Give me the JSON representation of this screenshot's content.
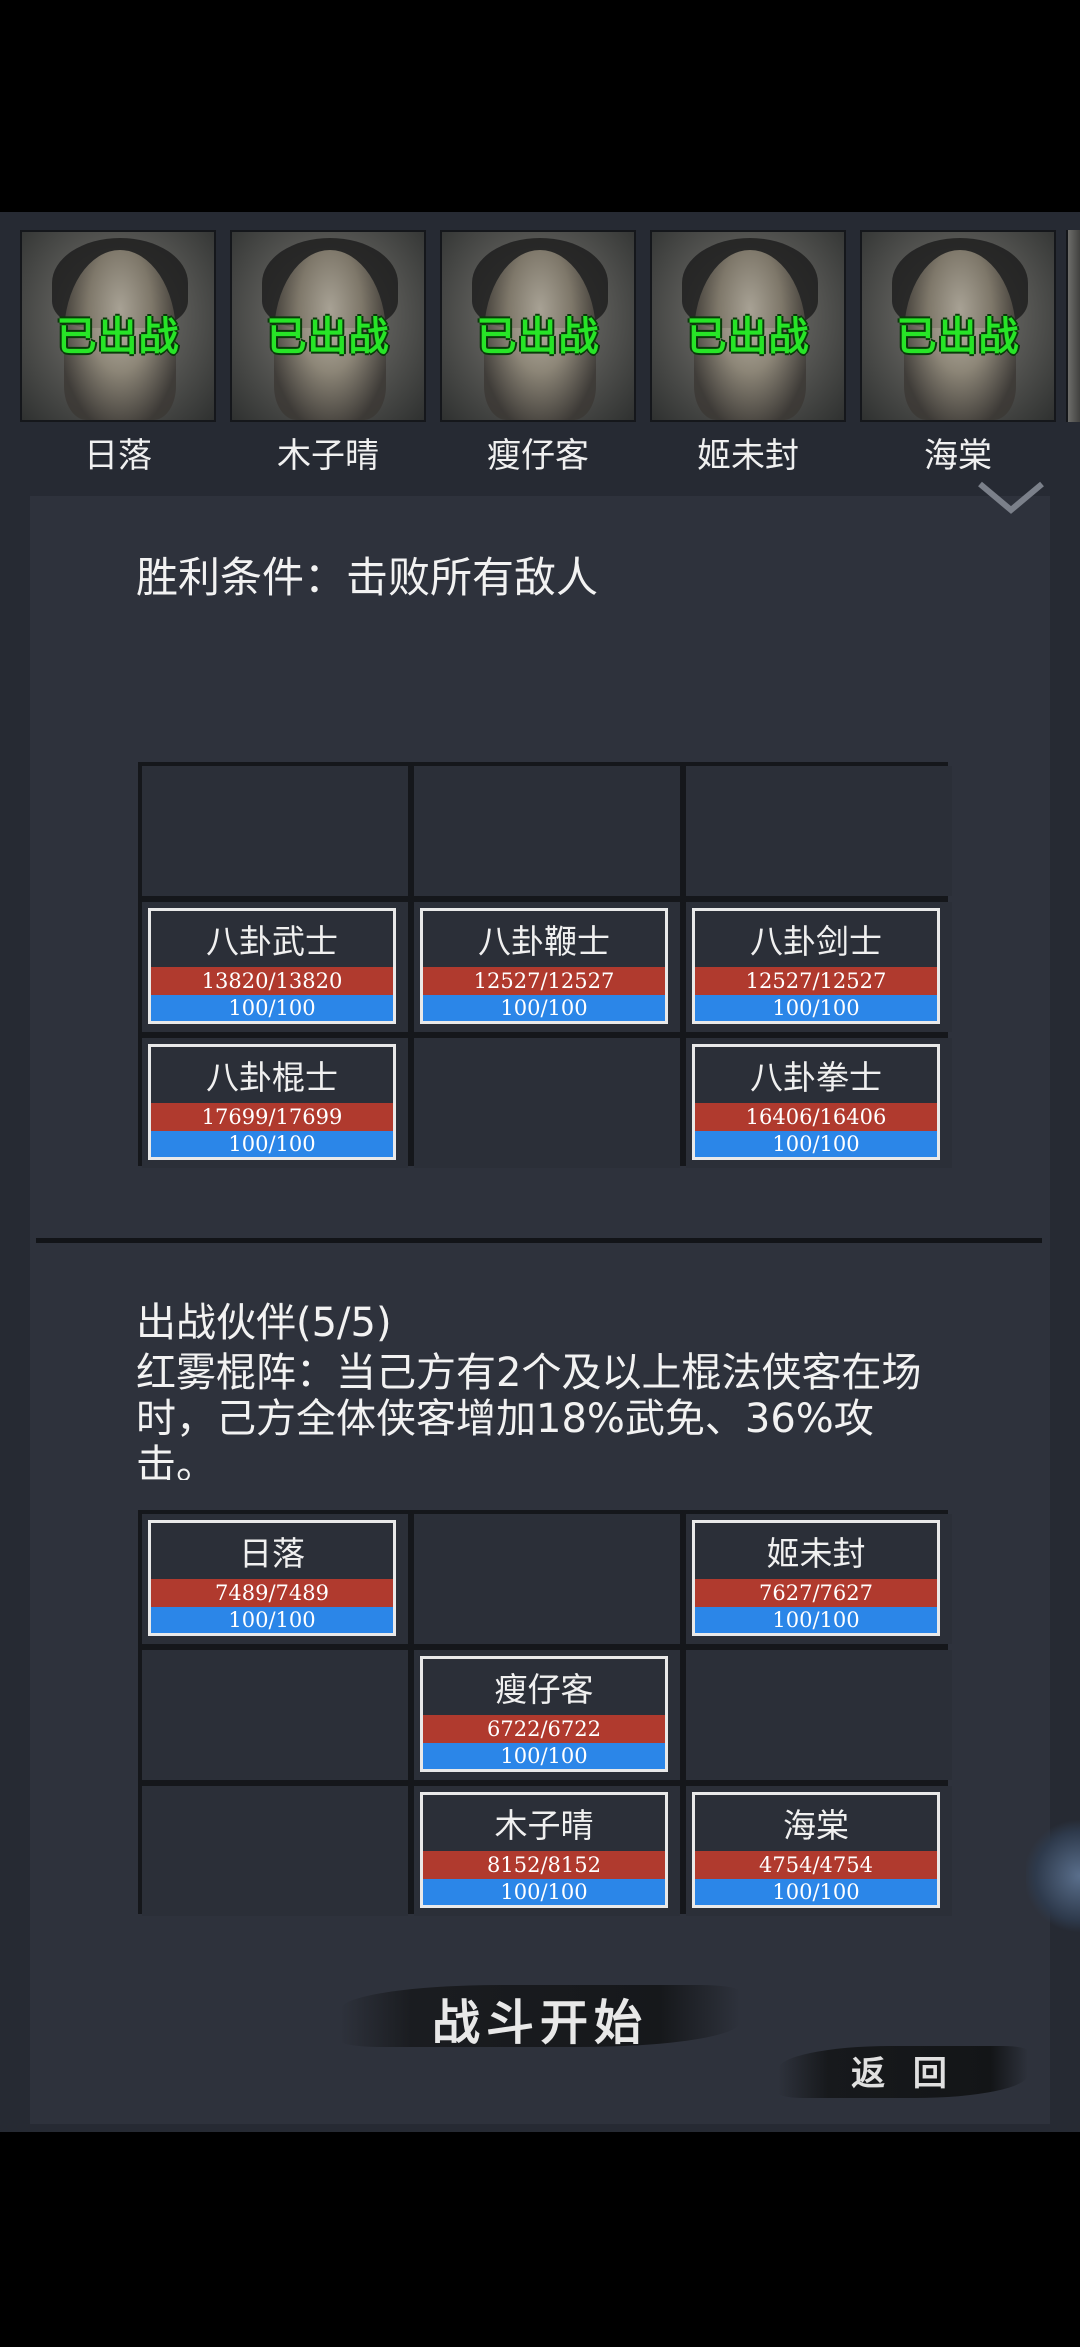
{
  "roster": {
    "status_label": "已出战",
    "heroes": [
      {
        "name": "日落"
      },
      {
        "name": "木子晴"
      },
      {
        "name": "瘦仔客"
      },
      {
        "name": "姬未封"
      },
      {
        "name": "海棠"
      }
    ]
  },
  "battle": {
    "victory_condition": "胜利条件：击败所有敌人",
    "enemy_grid": [
      [
        null,
        null,
        null
      ],
      [
        {
          "name": "八卦武士",
          "hp": "13820/13820",
          "mp": "100/100"
        },
        {
          "name": "八卦鞭士",
          "hp": "12527/12527",
          "mp": "100/100"
        },
        {
          "name": "八卦剑士",
          "hp": "12527/12527",
          "mp": "100/100"
        }
      ],
      [
        {
          "name": "八卦棍士",
          "hp": "17699/17699",
          "mp": "100/100"
        },
        null,
        {
          "name": "八卦拳士",
          "hp": "16406/16406",
          "mp": "100/100"
        }
      ]
    ],
    "team_title": "出战伙伴(5/5)",
    "formation_bonus": "红雾棍阵：当己方有2个及以上棍法侠客在场时，己方全体侠客增加18%武免、36%攻击。",
    "ally_grid": [
      [
        {
          "name": "日落",
          "hp": "7489/7489",
          "mp": "100/100"
        },
        null,
        {
          "name": "姬未封",
          "hp": "7627/7627",
          "mp": "100/100"
        }
      ],
      [
        null,
        {
          "name": "瘦仔客",
          "hp": "6722/6722",
          "mp": "100/100"
        },
        null
      ],
      [
        null,
        {
          "name": "木子晴",
          "hp": "8152/8152",
          "mp": "100/100"
        },
        {
          "name": "海棠",
          "hp": "4754/4754",
          "mp": "100/100"
        }
      ]
    ]
  },
  "buttons": {
    "start": "战斗开始",
    "back": "返 回"
  },
  "colors": {
    "deployed_green": "#27e527",
    "hp_red": "#b03a2e",
    "mp_blue": "#2b86e8",
    "panel_bg": "#2e323c"
  },
  "icons": {
    "collapse": "chevron-down-icon",
    "side_badge": "menu-badge-icon"
  }
}
